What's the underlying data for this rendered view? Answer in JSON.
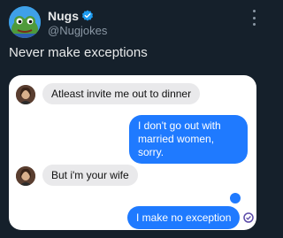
{
  "account": {
    "display_name": "Nugs",
    "handle": "@Nugjokes"
  },
  "tweet": {
    "text": "Never make exceptions"
  },
  "conversation": {
    "messages": [
      {
        "side": "in",
        "text": "Atleast invite me out to dinner"
      },
      {
        "side": "out",
        "text": "I don't go out with married women, sorry."
      },
      {
        "side": "in",
        "text": "But i'm your wife"
      },
      {
        "side": "out",
        "text": "I make no exception"
      }
    ]
  },
  "icons": {
    "avatar": "frog-avatar-icon",
    "verified": "verified-badge-icon",
    "more": "more-options-icon",
    "status": "delivered-icon"
  },
  "colors": {
    "background": "#15202b",
    "accent": "#1d9bf0",
    "incoming_bubble": "#e9e9eb",
    "outgoing_bubble": "#1f7aff"
  }
}
